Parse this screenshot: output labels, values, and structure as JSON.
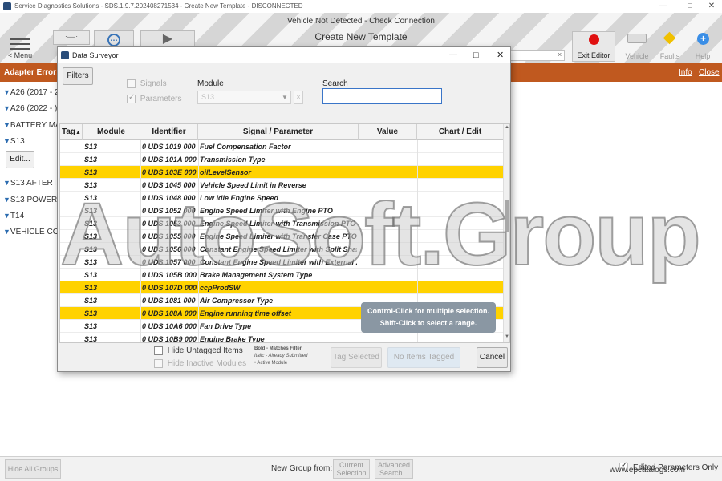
{
  "app": {
    "title": "Service Diagnostics Solutions - SDS.1.9.7.202408271534 - Create New Template - DISCONNECTED",
    "status": "Vehicle Not Detected - Check Connection",
    "page_title": "Create New Template"
  },
  "toolbar": {
    "menu_label": "< Menu",
    "exit_editor": "Exit Editor",
    "vehicle": "Vehicle",
    "faults": "Faults",
    "help": "Help"
  },
  "error_bar": {
    "label": "Adapter Error:",
    "info": "Info",
    "close": "Close"
  },
  "groups": [
    {
      "label": "A26 (2017 - 2"
    },
    {
      "label": "A26 (2022 - )"
    },
    {
      "label": "BATTERY MA"
    },
    {
      "label": "S13"
    },
    {
      "label": "S13 AFTERTR"
    },
    {
      "label": "S13 POWERT"
    },
    {
      "label": "T14"
    },
    {
      "label": "VEHICLE CO"
    }
  ],
  "edit_button": "Edit...",
  "dialog": {
    "title": "Data Surveyor",
    "filters_button": "Filters",
    "signals_label": "Signals",
    "parameters_label": "Parameters",
    "module_label": "Module",
    "module_value": "S13",
    "search_label": "Search",
    "search_value": "",
    "columns": [
      "Tag",
      "Module",
      "Identifier",
      "Signal / Parameter",
      "Value",
      "Chart / Edit"
    ],
    "rows": [
      {
        "module": "S13",
        "identifier": "0 UDS 1019 000",
        "parameter": "Fuel Compensation Factor",
        "highlight": false
      },
      {
        "module": "S13",
        "identifier": "0 UDS 101A 000",
        "parameter": "Transmission Type",
        "highlight": false
      },
      {
        "module": "S13",
        "identifier": "0 UDS 103E 000",
        "parameter": "oilLevelSensor",
        "highlight": true
      },
      {
        "module": "S13",
        "identifier": "0 UDS 1045 000",
        "parameter": "Vehicle Speed Limit in Reverse",
        "highlight": false
      },
      {
        "module": "S13",
        "identifier": "0 UDS 1048 000",
        "parameter": "Low Idle Engine Speed",
        "highlight": false
      },
      {
        "module": "S13",
        "identifier": "0 UDS 1052 000",
        "parameter": "Engine Speed Limiter with Engine PTO",
        "highlight": false
      },
      {
        "module": "S13",
        "identifier": "0 UDS 1053 000",
        "parameter": "Engine Speed Limiter with Transmission PTO",
        "highlight": false
      },
      {
        "module": "S13",
        "identifier": "0 UDS 1055 000",
        "parameter": "Engine Speed Limiter with Transfer Case PTO",
        "highlight": false
      },
      {
        "module": "S13",
        "identifier": "0 UDS 1056 000",
        "parameter": "Constant Engine Speed Limiter with Split Shaf...",
        "highlight": false
      },
      {
        "module": "S13",
        "identifier": "0 UDS 1057 000",
        "parameter": "Constant Engine Speed Limiter with External ...",
        "highlight": false
      },
      {
        "module": "S13",
        "identifier": "0 UDS 105B 000",
        "parameter": "Brake Management System Type",
        "highlight": false
      },
      {
        "module": "S13",
        "identifier": "0 UDS 107D 000",
        "parameter": "ccpProdSW",
        "highlight": true
      },
      {
        "module": "S13",
        "identifier": "0 UDS 1081 000",
        "parameter": "Air Compressor Type",
        "highlight": false
      },
      {
        "module": "S13",
        "identifier": "0 UDS 108A 000",
        "parameter": "Engine running time offset",
        "highlight": true
      },
      {
        "module": "S13",
        "identifier": "0 UDS 10A6 000",
        "parameter": "Fan Drive Type",
        "highlight": false
      },
      {
        "module": "S13",
        "identifier": "0 UDS 10B9 000",
        "parameter": "Engine Brake Type",
        "highlight": false
      }
    ],
    "tooltip_line1": "Control-Click for multiple selection.",
    "tooltip_line2": "Shift-Click to select a range.",
    "hide_untagged": "Hide Untagged Items",
    "hide_inactive": "Hide Inactive Modules",
    "legend_bold": "Bold - Matches Filter",
    "legend_italic": "Italic - Already Submitted",
    "legend_active": "• Active Module",
    "tag_selected": "Tag Selected",
    "no_items_tagged": "No Items Tagged",
    "cancel": "Cancel"
  },
  "bottom": {
    "hide_all_groups": "Hide All Groups",
    "new_group_from": "New Group from:",
    "current_selection_1": "Current",
    "current_selection_2": "Selection",
    "advanced_search_1": "Advanced",
    "advanced_search_2": "Search...",
    "edited_parameters_only": "Edited Parameters Only"
  },
  "watermark": "AutoSoft.Group",
  "site_mark": "www.epcatalogs.com",
  "colors": {
    "error_bar": "#c0591f",
    "highlight_row": "#ffd200",
    "exit_editor_dot": "#e01010",
    "faults_dot": "#f0c000",
    "help_icon": "#3a8ee6"
  }
}
